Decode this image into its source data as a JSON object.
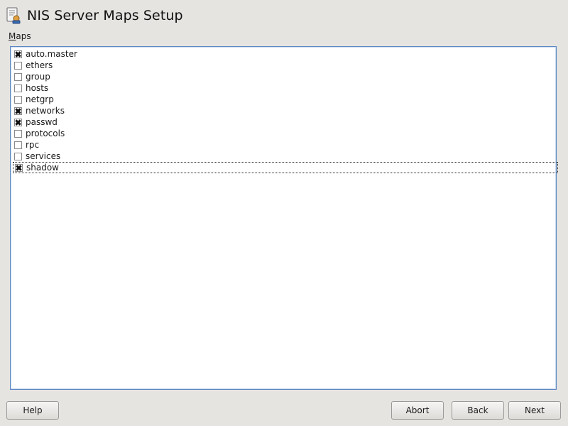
{
  "window": {
    "title": "NIS Server Maps Setup",
    "icon": "server-config-icon"
  },
  "maps": {
    "label": "Maps",
    "items": [
      {
        "label": "auto.master",
        "checked": true
      },
      {
        "label": "ethers",
        "checked": false
      },
      {
        "label": "group",
        "checked": false
      },
      {
        "label": "hosts",
        "checked": false
      },
      {
        "label": "netgrp",
        "checked": false
      },
      {
        "label": "networks",
        "checked": true
      },
      {
        "label": "passwd",
        "checked": true
      },
      {
        "label": "protocols",
        "checked": false
      },
      {
        "label": "rpc",
        "checked": false
      },
      {
        "label": "services",
        "checked": false
      },
      {
        "label": "shadow",
        "checked": true
      }
    ],
    "focused_item": "shadow"
  },
  "buttons": {
    "help": "Help",
    "abort": "Abort",
    "back": "Back",
    "next": "Next"
  },
  "colors": {
    "background": "#e6e4e1",
    "list_border": "#5b87c2"
  }
}
